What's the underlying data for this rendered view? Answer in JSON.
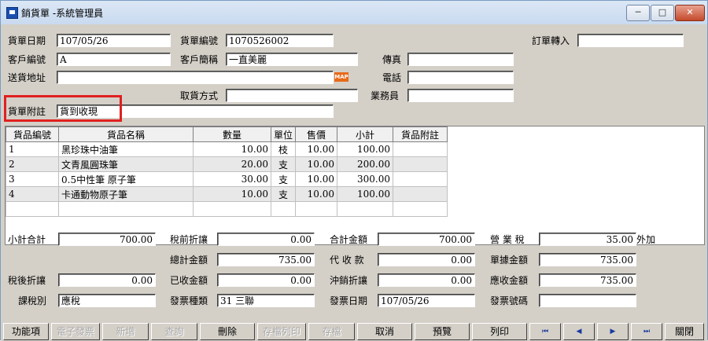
{
  "window": {
    "title": "銷貨單 -系統管理員",
    "controls": [
      "─",
      "□",
      "✕"
    ]
  },
  "header": {
    "date_label": "貨單日期",
    "date": "107/05/26",
    "no_label": "貨單編號",
    "no": "1070526002",
    "order_label": "訂單轉入",
    "order": "",
    "cust_label": "客戶編號",
    "cust": "A",
    "cust_name_label": "客戶簡稱",
    "cust_name": "一直美麗",
    "fax_label": "傳真",
    "fax": "",
    "addr_label": "送貨地址",
    "addr": "",
    "map": "MAP",
    "tel_label": "電話",
    "tel": "",
    "pickup_label": "取貨方式",
    "pickup": "",
    "sales_label": "業務員",
    "sales": "",
    "note_label": "貨單附註",
    "note": "貨到收現"
  },
  "grid": {
    "columns": [
      "貨品編號",
      "貨品名稱",
      "數量",
      "單位",
      "售價",
      "小計",
      "貨品附註"
    ],
    "rows": [
      [
        "1",
        "黑珍珠中油筆",
        "10.00",
        "枝",
        "10.00",
        "100.00",
        ""
      ],
      [
        "2",
        "文青風圓珠筆",
        "20.00",
        "支",
        "10.00",
        "200.00",
        ""
      ],
      [
        "3",
        "0.5中性筆 原子筆",
        "30.00",
        "支",
        "10.00",
        "300.00",
        ""
      ],
      [
        "4",
        "卡通動物原子筆",
        "10.00",
        "支",
        "10.00",
        "100.00",
        ""
      ]
    ]
  },
  "totals": {
    "subtotal_label": "小計合計",
    "subtotal": "700.00",
    "pre_disc_label": "稅前折讓",
    "pre_disc": "0.00",
    "sum_label": "合計金額",
    "sum": "700.00",
    "tax_label": "營 業 稅",
    "tax": "35.00",
    "tax_suffix": "外加",
    "total_label": "總計金額",
    "total": "735.00",
    "collect_label": "代 收 款",
    "collect": "0.00",
    "doc_amt_label": "單據金額",
    "doc_amt": "735.00",
    "post_disc_label": "稅後折讓",
    "post_disc": "0.00",
    "received_label": "已收金額",
    "received": "0.00",
    "offset_label": "沖銷折讓",
    "offset": "0.00",
    "receivable_label": "應收金額",
    "receivable": "735.00",
    "taxtype_label": "課稅別",
    "taxtype": "應稅",
    "invtype_label": "發票種類",
    "invtype": "31 三聯",
    "invdate_label": "發票日期",
    "invdate": "107/05/26",
    "invno_label": "發票號碼",
    "invno": ""
  },
  "buttons": {
    "func": "功能項",
    "einv": "電子發票",
    "add": "新增",
    "query": "查詢",
    "del": "刪除",
    "saveprint": "存檔列印",
    "save": "存檔",
    "cancel": "取消",
    "preview": "預覽",
    "print": "列印",
    "first": "⏮",
    "prev": "◀",
    "next": "▶",
    "last": "⏭",
    "close": "關閉"
  },
  "colors": {
    "highlight": "#e02020",
    "titlebar": "#c9daf0"
  }
}
